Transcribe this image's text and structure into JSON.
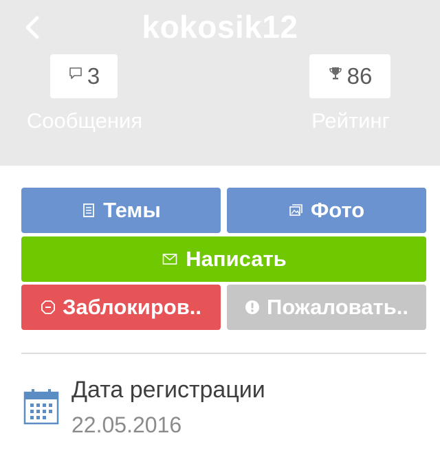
{
  "header": {
    "username": "kokosik12",
    "back_icon": "chevron-left-icon",
    "messages": {
      "count": "3",
      "label": "Сообщения",
      "icon": "speech-bubble-icon"
    },
    "rating": {
      "count": "86",
      "label": "Рейтинг",
      "icon": "trophy-icon"
    }
  },
  "actions": {
    "topics": "Темы",
    "photo": "Фото",
    "write": "Написать",
    "block": "Заблокиров..",
    "report": "Пожаловать.."
  },
  "registration": {
    "title": "Дата регистрации",
    "date": "22.05.2016",
    "icon": "calendar-icon"
  },
  "colors": {
    "header_bg": "#e9e9e9",
    "blue": "#6a93cf",
    "green": "#6fc800",
    "red": "#e65458",
    "gray": "#c6c6c6"
  }
}
